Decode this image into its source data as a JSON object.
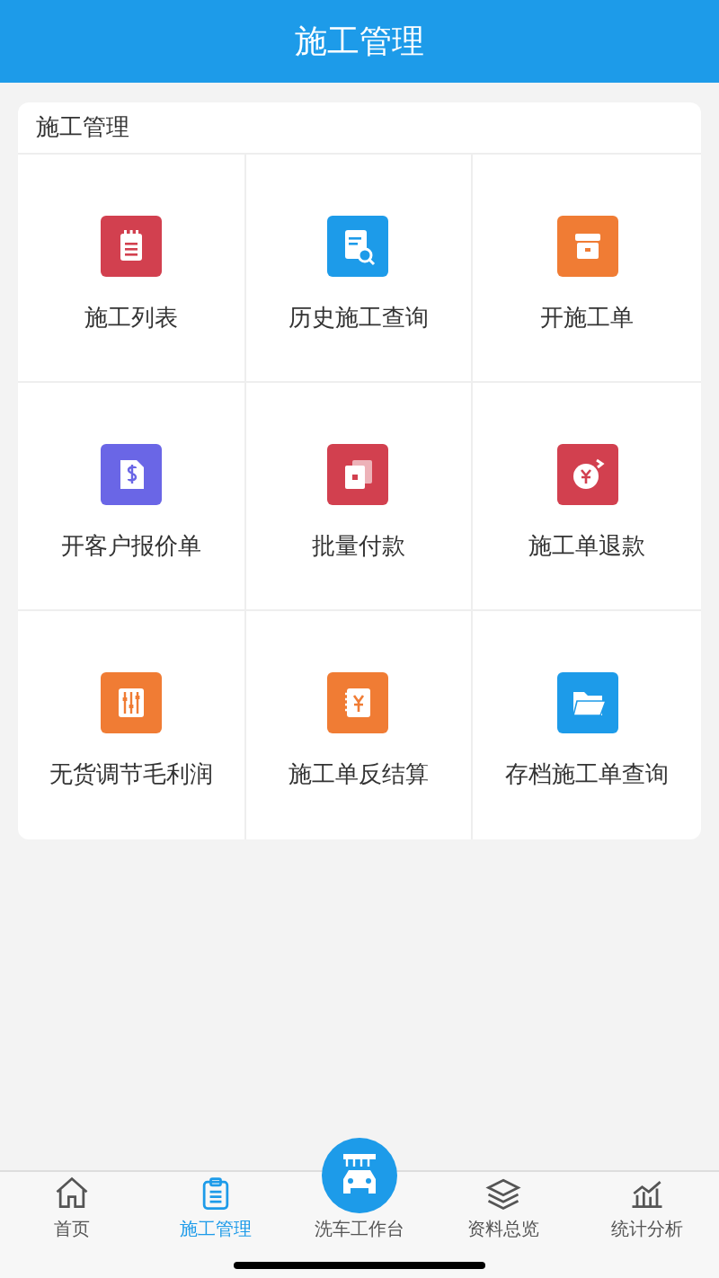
{
  "header": {
    "title": "施工管理"
  },
  "panel": {
    "title": "施工管理",
    "items": [
      {
        "label": "施工列表",
        "color": "#d2404f"
      },
      {
        "label": "历史施工查询",
        "color": "#1d9be9"
      },
      {
        "label": "开施工单",
        "color": "#f07c34"
      },
      {
        "label": "开客户报价单",
        "color": "#6a66e6"
      },
      {
        "label": "批量付款",
        "color": "#d2404f"
      },
      {
        "label": "施工单退款",
        "color": "#d2404f"
      },
      {
        "label": "无货调节毛利润",
        "color": "#f07c34"
      },
      {
        "label": "施工单反结算",
        "color": "#f07c34"
      },
      {
        "label": "存档施工单查询",
        "color": "#1d9be9"
      }
    ]
  },
  "tab_bar": [
    {
      "label": "首页",
      "selected": false
    },
    {
      "label": "施工管理",
      "selected": true
    },
    {
      "label": "洗车工作台",
      "selected": false
    },
    {
      "label": "资料总览",
      "selected": false
    },
    {
      "label": "统计分析",
      "selected": false
    }
  ]
}
